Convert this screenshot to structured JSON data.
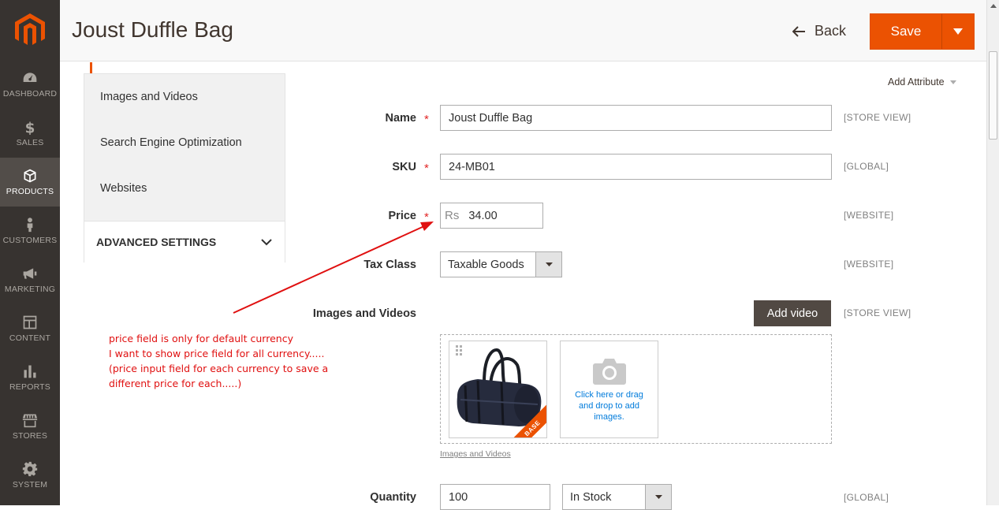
{
  "sidebar": {
    "items": [
      {
        "label": "DASHBOARD",
        "icon": "dashboard-icon"
      },
      {
        "label": "SALES",
        "icon": "dollar-icon"
      },
      {
        "label": "PRODUCTS",
        "icon": "cube-icon"
      },
      {
        "label": "CUSTOMERS",
        "icon": "person-icon"
      },
      {
        "label": "MARKETING",
        "icon": "megaphone-icon"
      },
      {
        "label": "CONTENT",
        "icon": "layout-icon"
      },
      {
        "label": "REPORTS",
        "icon": "bar-chart-icon"
      },
      {
        "label": "STORES",
        "icon": "store-icon"
      },
      {
        "label": "SYSTEM",
        "icon": "gear-icon"
      }
    ],
    "active": "PRODUCTS"
  },
  "header": {
    "title": "Joust Duffle Bag",
    "back_label": "Back",
    "save_label": "Save"
  },
  "left_nav": {
    "links": [
      "Images and Videos",
      "Search Engine Optimization",
      "Websites"
    ],
    "advanced_label": "ADVANCED SETTINGS"
  },
  "form": {
    "add_attribute": "Add Attribute",
    "name": {
      "label": "Name",
      "value": "Joust Duffle Bag",
      "scope": "[STORE VIEW]"
    },
    "sku": {
      "label": "SKU",
      "value": "24-MB01",
      "scope": "[GLOBAL]"
    },
    "price": {
      "label": "Price",
      "currency": "Rs",
      "value": "34.00",
      "scope": "[WEBSITE]"
    },
    "tax_class": {
      "label": "Tax Class",
      "value": "Taxable Goods",
      "scope": "[WEBSITE]"
    },
    "images": {
      "label": "Images and Videos",
      "add_video": "Add video",
      "scope": "[STORE VIEW]",
      "base_badge": "BASE",
      "upload_text": "Click here or drag and drop to add images.",
      "caption": "Images and Videos"
    },
    "quantity": {
      "label": "Quantity",
      "value": "100",
      "stock_status": "In Stock",
      "scope": "[GLOBAL]"
    }
  },
  "annotation": {
    "lines": [
      "price field is only for default currency",
      "I want to show price field for all currency.....",
      "(price input field for each currency to save a",
      "different price for each.....)"
    ],
    "color": "#e01010"
  },
  "colors": {
    "sidebar_bg": "#373330",
    "accent": "#eb5202",
    "required": "#e22626",
    "link": "#007bdb"
  }
}
